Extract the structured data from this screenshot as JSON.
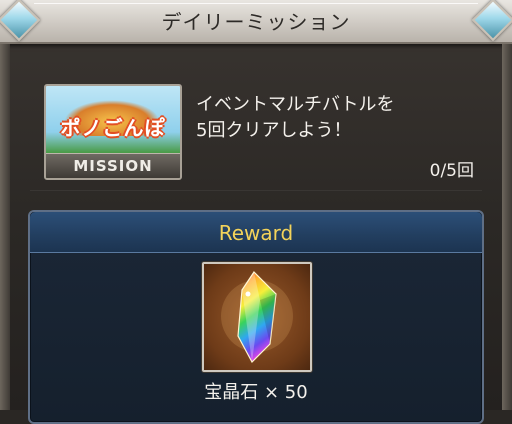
{
  "header": {
    "title": "デイリーミッション"
  },
  "mission": {
    "banner_text": "ポノごんぽ",
    "banner_label": "MISSION",
    "description": "イベントマルチバトルを\n5回クリアしよう！",
    "progress": "0/5回",
    "progress_value": 0,
    "progress_max": 5
  },
  "reward": {
    "title": "Reward",
    "item_name": "宝晶石 × 50",
    "item_icon": "crystal-icon"
  },
  "colors": {
    "reward_title": "#f3d35a",
    "reward_header": "#2c4f78",
    "panel_background": "#1b2737"
  }
}
